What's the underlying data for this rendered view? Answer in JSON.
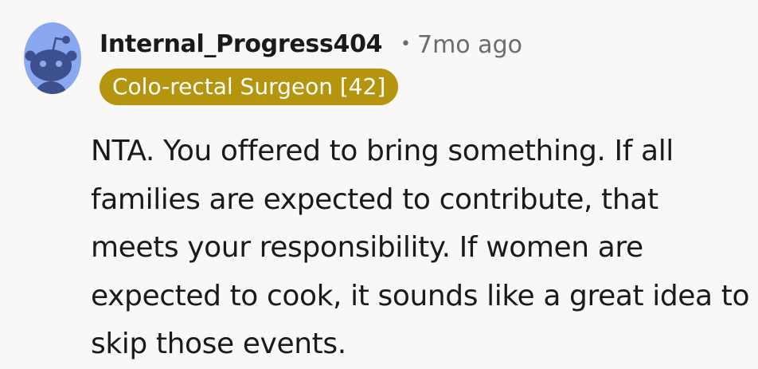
{
  "comment": {
    "avatar_icon": "reddit-snoo-avatar-icon",
    "username": "Internal_Progress404",
    "separator": "•",
    "timestamp": "7mo ago",
    "flair": "Colo-rectal Surgeon [42]",
    "body": "NTA. You offered to bring something. If all families are expected to contribute, that meets your responsibility. If women are expected to cook, it sounds like a great idea to skip those events."
  },
  "colors": {
    "background": "#faf8f7",
    "avatar_bg": "#8aa8f0",
    "flair_bg": "#b5940e",
    "meta_text": "#6a6c6e"
  }
}
